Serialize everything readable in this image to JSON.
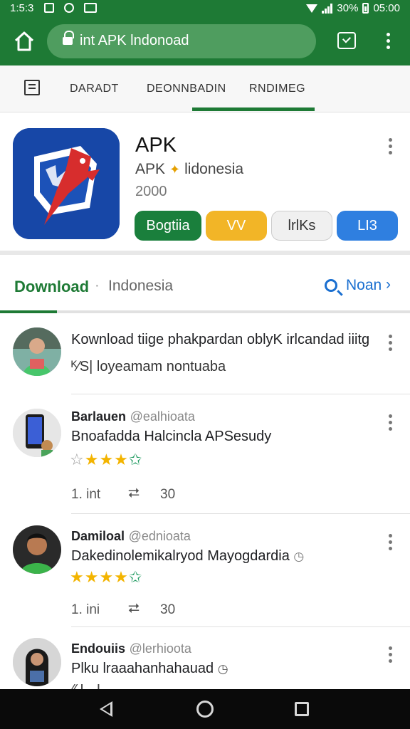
{
  "status_bar": {
    "time": "1:5:3",
    "battery": "30%",
    "clock": "05:00"
  },
  "url_bar": {
    "text": "int APK lndonoad"
  },
  "category_tabs": [
    "DARADT",
    "DEONNBADIN",
    "RNDIMEG"
  ],
  "app": {
    "title": "APK",
    "subtitle_left": "APK",
    "subtitle_right": "lidonesia",
    "year": "2000",
    "pills": [
      {
        "label": "Bogtiia",
        "bg": "#1a7f3c",
        "fg": "#ffffff"
      },
      {
        "label": "VV",
        "bg": "#f2b527",
        "fg": "#ffffff"
      },
      {
        "label": "lrlKs",
        "bg": "#f0f0f0",
        "fg": "#333333"
      },
      {
        "label": "LI3",
        "bg": "#2f7fe0",
        "fg": "#ffffff"
      }
    ]
  },
  "download_section": {
    "title": "Download",
    "separator": "·",
    "subtitle": "Indonesia",
    "more": "Noan"
  },
  "posts": [
    {
      "line1": "Kownload tiige phakpardan oblyK irlcandad iiitg",
      "line2": "ᴷ⁄S| loyeamam nontuaba"
    },
    {
      "name": "Barlauen",
      "handle": "@ealhioata",
      "text": "Bnoafadda Halcincla APSesudy",
      "rating": "3.5",
      "likes": "1. int",
      "retweets": "30"
    },
    {
      "name": "Damiloal",
      "handle": "@ednioata",
      "text": "Dakedinolemikalryod Mayogdardia",
      "rating": "3.5",
      "likes": "1. ini",
      "retweets": "30"
    },
    {
      "name": "Endouiis",
      "handle": "@lerhioota",
      "text": "Plku lraaahanhahauad",
      "text2": "⁄⁄   I ·  I  ·  "
    }
  ],
  "colors": {
    "primary": "#1e7a35",
    "url_bg": "#4f9d5f",
    "accent_blue": "#1a6fd0",
    "star": "#f3b400"
  }
}
